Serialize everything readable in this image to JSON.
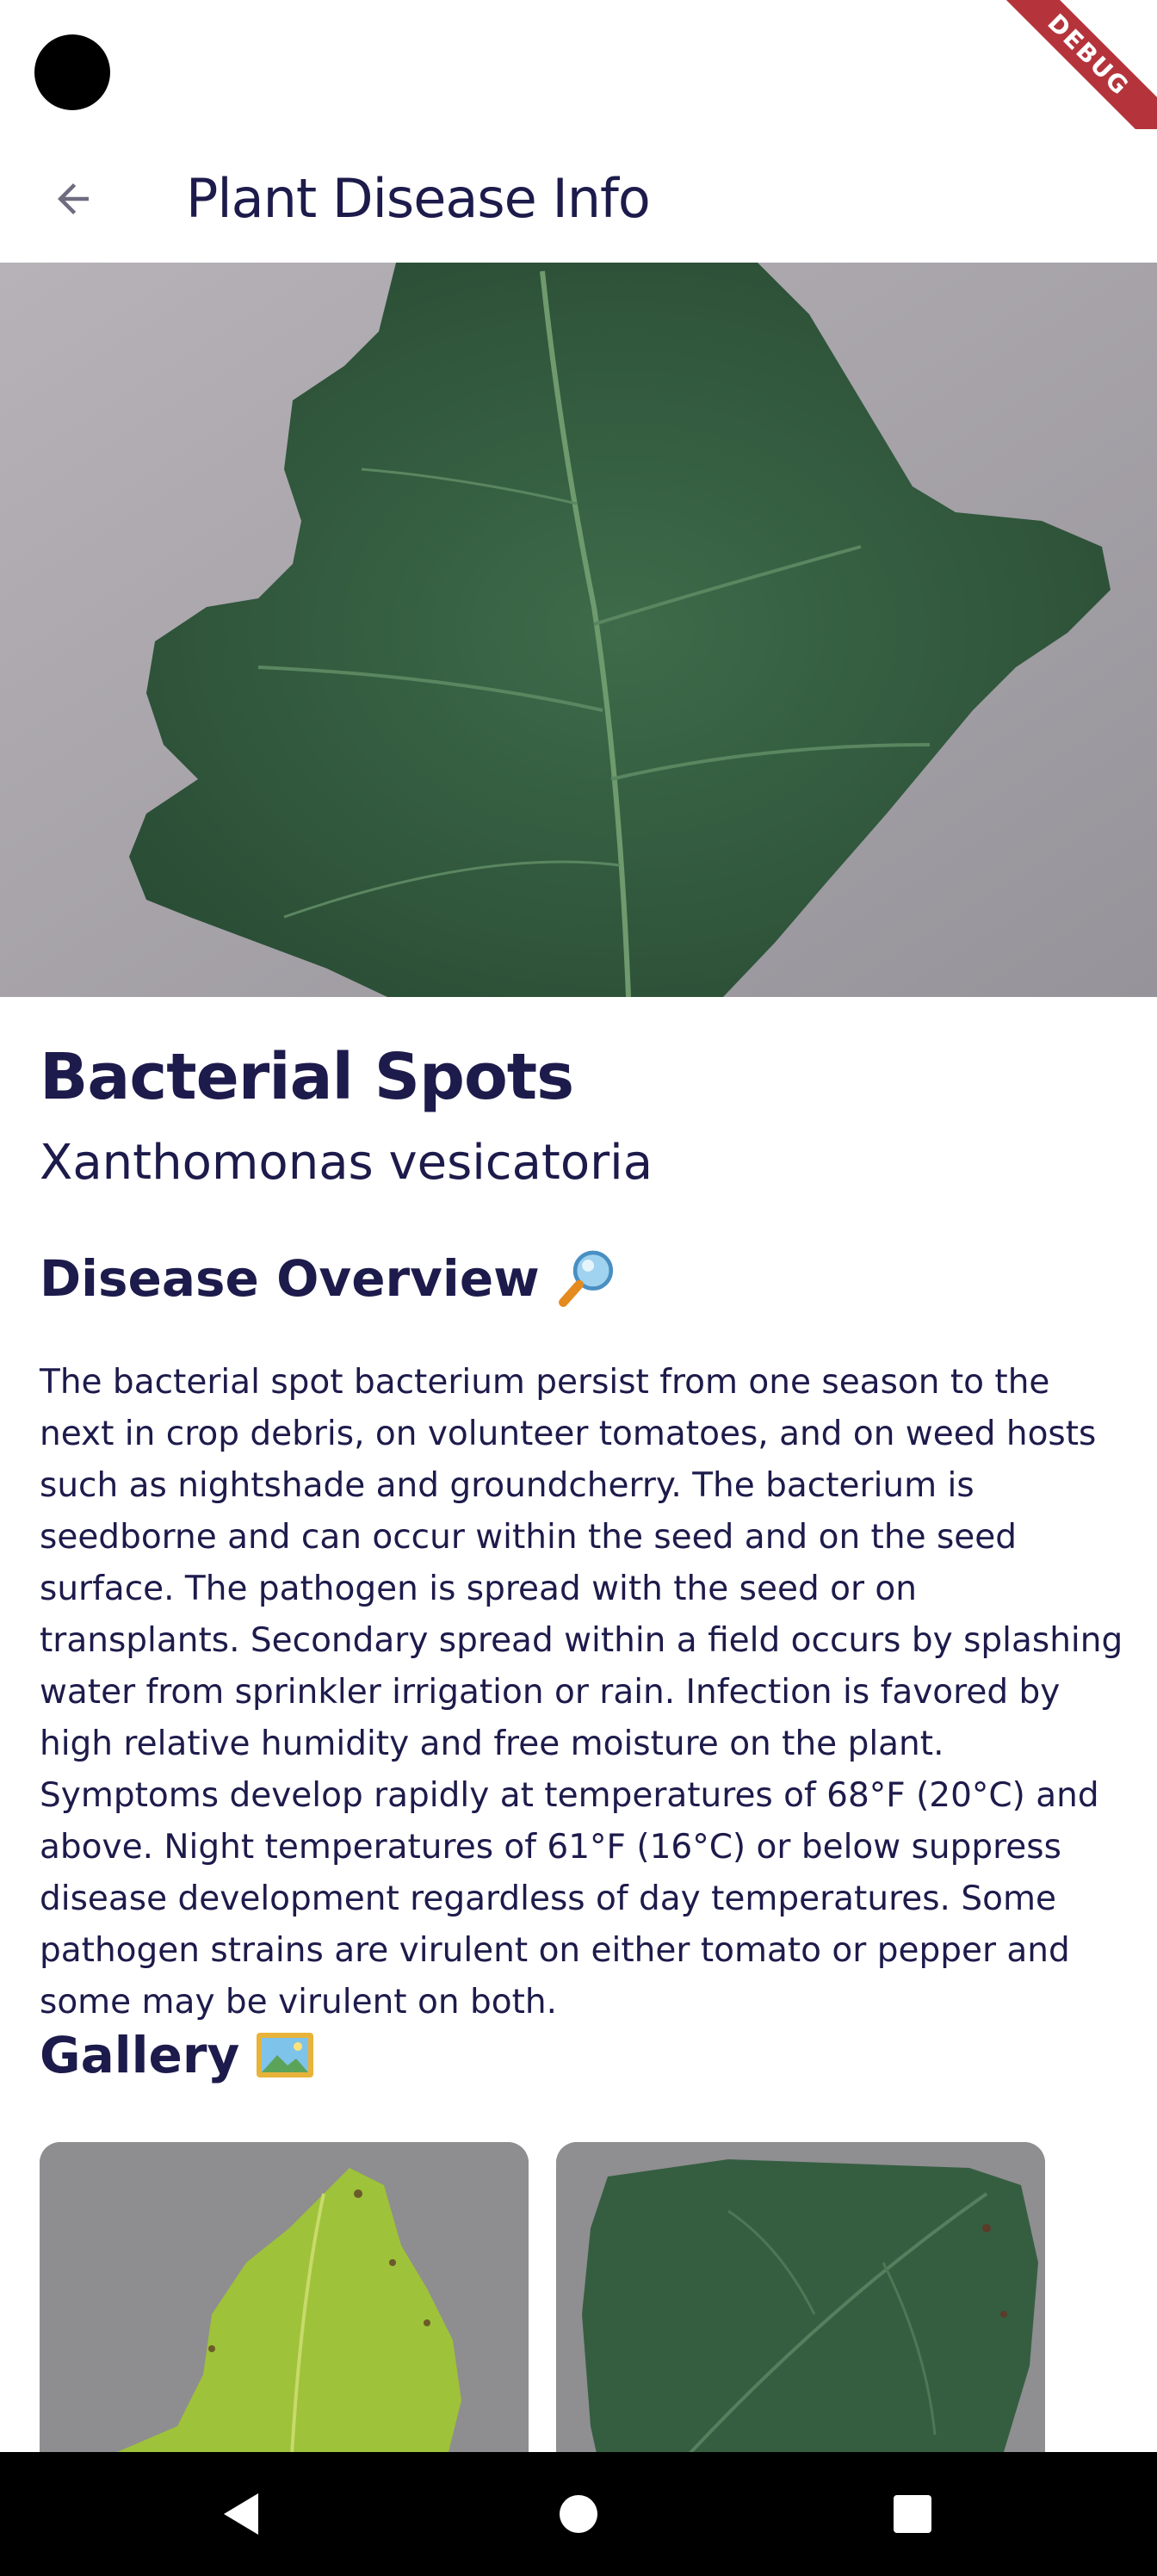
{
  "debug_banner": {
    "label": "DEBUG"
  },
  "app_bar": {
    "title": "Plant Disease Info",
    "back_icon": "arrow-back-icon"
  },
  "hero": {
    "image": "tomato-leaf-photo"
  },
  "disease": {
    "name": "Bacterial Spots",
    "scientific_name": "Xanthomonas vesicatoria"
  },
  "overview": {
    "heading": "Disease Overview",
    "icon": "magnifying-glass-icon",
    "text": "The bacterial spot bacterium persist from one season to the next in crop debris, on volunteer tomatoes, and on weed hosts such as nightshade and groundcherry. The bacterium is seedborne and can occur within the seed and on the seed surface. The pathogen is spread with the seed or on transplants. Secondary spread within a field occurs by splashing water from sprinkler irrigation or rain. Infection is favored by high relative humidity and free moisture on the plant. Symptoms develop rapidly at temperatures of 68°F (20°C) and above. Night temperatures of 61°F (16°C) or below suppress disease development regardless of day temperatures. Some pathogen strains are virulent on either tomato or pepper and some may be virulent on both."
  },
  "gallery": {
    "heading": "Gallery",
    "icon": "framed-picture-icon",
    "items": [
      {
        "image": "yellowing-leaf-photo"
      },
      {
        "image": "green-leaf-photo"
      }
    ]
  },
  "nav": {
    "back": "nav-back-icon",
    "home": "nav-home-icon",
    "recents": "nav-recents-icon"
  },
  "colors": {
    "primary_text": "#1d1b4b",
    "debug_ribbon": "#b5343b",
    "nav_bar": "#000000"
  }
}
